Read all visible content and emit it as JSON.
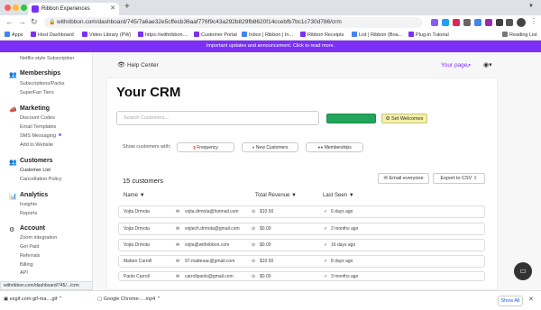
{
  "browser": {
    "tab_title": "Ribbon Experiences",
    "url": "withribbon.com/dashboard/745/7a6ae32e5cffecb36aaf776f9c43a292b829fb8620f14ccebfb7bc1c730d786/crm",
    "bookmarks": [
      "Apps",
      "Host Dashboard",
      "Video Library (PW)",
      "https://withribbon....",
      "Customer Portal",
      "Inbox | Ribbon | In...",
      "Ribbon Receipts",
      "List | Ribbon (Boa...",
      "Plug-in Tutorial",
      "Reading List"
    ]
  },
  "announcement": "Important updates and announcement. Click to read more.",
  "sidebar": {
    "top_item": "Netflix-style Subscription",
    "sections": [
      {
        "title": "Memberships",
        "icon": "users-icon",
        "items": [
          "Subscriptions/Packs",
          "SuperFan Tiers"
        ]
      },
      {
        "title": "Marketing",
        "icon": "megaphone-icon",
        "items": [
          "Discount Codes",
          "Email Templates",
          "SMS Messaging",
          "Add to Website"
        ]
      },
      {
        "title": "Customers",
        "icon": "customers-icon",
        "items": [
          "Customer List",
          "Cancellation Policy"
        ]
      },
      {
        "title": "Analytics",
        "icon": "analytics-icon",
        "items": [
          "Insights",
          "Reports"
        ]
      },
      {
        "title": "Account",
        "icon": "account-icon",
        "items": [
          "Zoom integration",
          "Get Paid",
          "Referrals",
          "Billing",
          "API"
        ]
      }
    ]
  },
  "header": {
    "help": "Help Center",
    "your_page": "Your page"
  },
  "main": {
    "title": "Your CRM",
    "search_placeholder": "Search Customers...",
    "green_button": "",
    "yellow_button": "Set Welcomes",
    "filter_label": "Show customers with:",
    "filters": [
      "Frequency",
      "New Customers",
      "Memberships"
    ],
    "count": "15 customers",
    "email_button": "Email everyone",
    "export_button": "Export to CSV",
    "columns": {
      "name": "Name",
      "revenue": "Total Revenue",
      "last_seen": "Last Seen"
    },
    "rows": [
      {
        "name": "Vojta Drmota",
        "email": "vojta.drmota@hotmail.com",
        "revenue": "$10.50",
        "last_seen": "6 days ago"
      },
      {
        "name": "Vojta Drmota",
        "email": "vojtech.drmota@gmail.com",
        "revenue": "$0.00",
        "last_seen": "2 months ago"
      },
      {
        "name": "Vojta Drmota",
        "email": "vojta@withribbon.com",
        "revenue": "$0.00",
        "last_seen": "16 days ago"
      },
      {
        "name": "Matteo Carroll",
        "email": "97.matteoac@gmail.com",
        "revenue": "$10.50",
        "last_seen": "8 days ago"
      },
      {
        "name": "Paolo Carroll",
        "email": "carrollpaolo@gmail.com",
        "revenue": "$0.00",
        "last_seen": "3 months ago"
      }
    ]
  },
  "status_url": "withribbon.com/dashboard/745/.../crm",
  "downloads": {
    "items": [
      "ezgif.com-gif-ma....gif",
      "Google Chrome-....mp4"
    ],
    "show_all": "Show All"
  },
  "colors": {
    "brand": "#7b2ff7",
    "green": "#22a55a",
    "yellow": "#f2f0a8"
  }
}
